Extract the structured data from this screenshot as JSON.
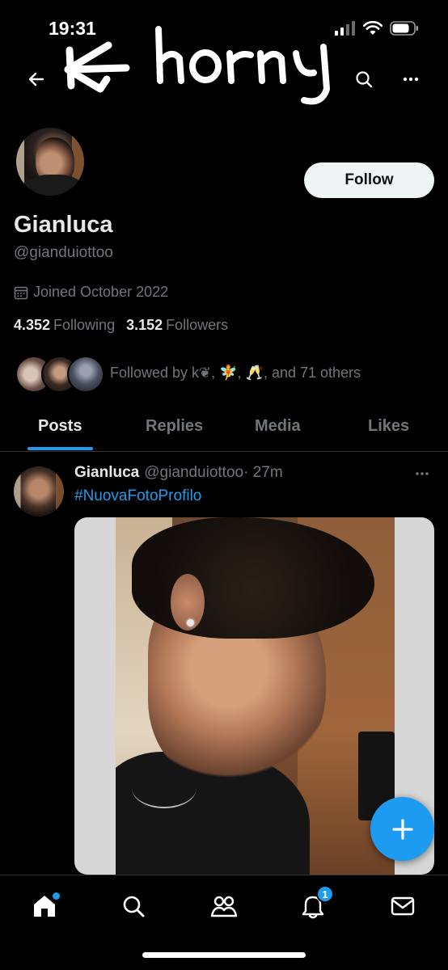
{
  "status_bar": {
    "time": "19:31"
  },
  "annotation": {
    "scribble_text": "horny"
  },
  "profile": {
    "follow_label": "Follow",
    "name": "Gianluca",
    "handle": "@gianduiottoo",
    "joined": "Joined October 2022",
    "following_count": "4.352",
    "following_label": "Following",
    "followers_count": "3.152",
    "followers_label": "Followers",
    "followed_by": "Followed by k❦, 🧚, 🥂, and 71 others"
  },
  "tabs": [
    {
      "label": "Posts",
      "active": true
    },
    {
      "label": "Replies",
      "active": false
    },
    {
      "label": "Media",
      "active": false
    },
    {
      "label": "Likes",
      "active": false
    }
  ],
  "tweet": {
    "author_name": "Gianluca",
    "author_handle": "@gianduiottoo",
    "time": "· 27m",
    "text": "#NuovaFotoProfilo"
  },
  "bottom_nav": {
    "items": [
      "home-icon",
      "search-icon",
      "communities-icon",
      "notifications-icon",
      "messages-icon"
    ],
    "notification_badge": "1"
  },
  "colors": {
    "accent": "#1d9bf0",
    "background": "#000000",
    "muted": "#71767b"
  }
}
